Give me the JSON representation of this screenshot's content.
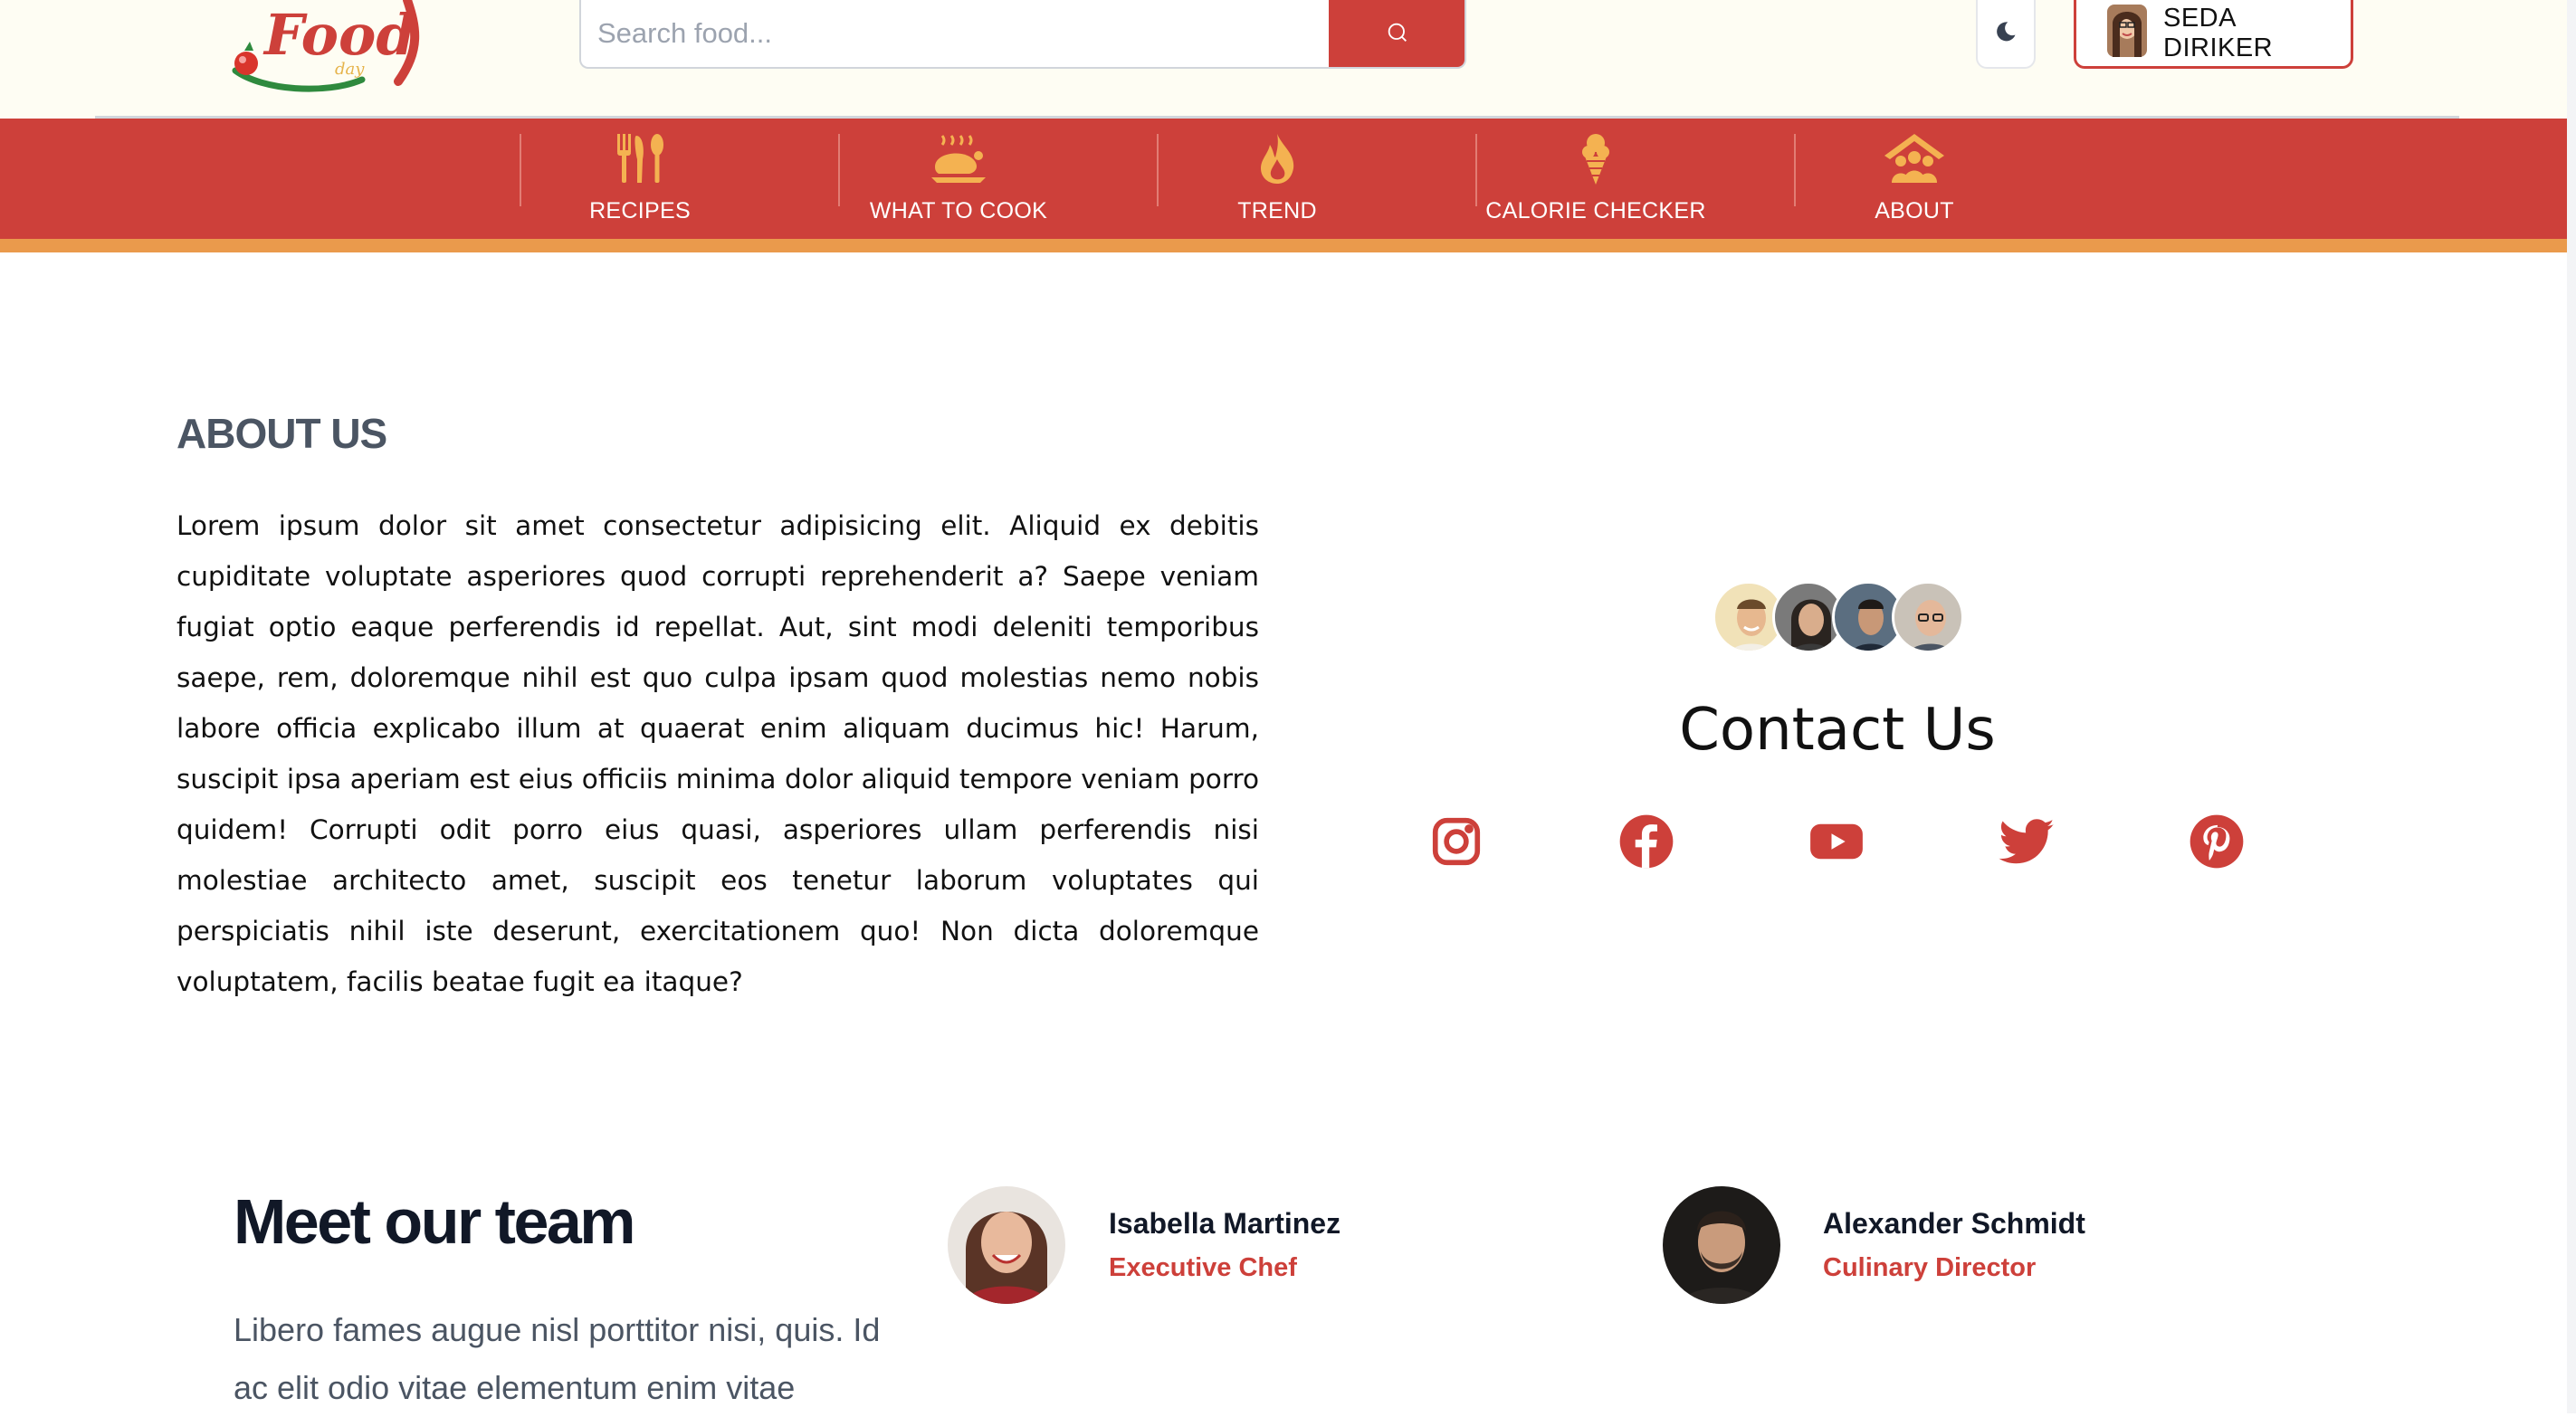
{
  "brand": {
    "logo_text": "Food",
    "logo_subtext": "day",
    "accent": "#cd403a",
    "stripe": "#ea9a4c"
  },
  "search": {
    "placeholder": "Search food...",
    "icon": "search-icon"
  },
  "header": {
    "theme_icon": "moon-icon",
    "user_name": "SEDA DIRIKER"
  },
  "nav": {
    "items": [
      {
        "label": "RECIPES",
        "icon": "cutlery-icon"
      },
      {
        "label": "WHAT TO COOK",
        "icon": "roast-chicken-icon"
      },
      {
        "label": "TREND",
        "icon": "flame-icon"
      },
      {
        "label": "CALORIE CHECKER",
        "icon": "ice-cream-icon"
      },
      {
        "label": "ABOUT",
        "icon": "people-house-icon"
      }
    ]
  },
  "about": {
    "title": "ABOUT US",
    "text": "Lorem ipsum dolor sit amet consectetur adipisicing elit. Aliquid ex debitis cupiditate voluptate asperiores quod corrupti reprehenderit a? Saepe veniam fugiat optio eaque perferendis id repellat. Aut, sint modi deleniti temporibus saepe, rem, doloremque nihil est quo culpa ipsam quod molestias nemo nobis labore officia explicabo illum at quaerat enim aliquam ducimus hic! Harum, suscipit ipsa aperiam est eius officiis minima dolor aliquid tempore veniam porro quidem! Corrupti odit porro eius quasi, asperiores ullam perferendis nisi molestiae architecto amet, suscipit eos tenetur laborum voluptates qui perspiciatis nihil iste deserunt, exercitationem quo! Non dicta doloremque voluptatem, facilis beatae fugit ea itaque?"
  },
  "contact": {
    "title": "Contact Us",
    "socials": [
      "instagram-icon",
      "facebook-icon",
      "youtube-icon",
      "twitter-icon",
      "pinterest-icon"
    ]
  },
  "team": {
    "title": "Meet our team",
    "description": "Libero fames augue nisl porttitor nisi, quis. Id ac elit odio vitae elementum enim vitae",
    "members": [
      {
        "name": "Isabella Martinez",
        "role": "Executive Chef"
      },
      {
        "name": "Alexander Schmidt",
        "role": "Culinary Director"
      }
    ]
  }
}
